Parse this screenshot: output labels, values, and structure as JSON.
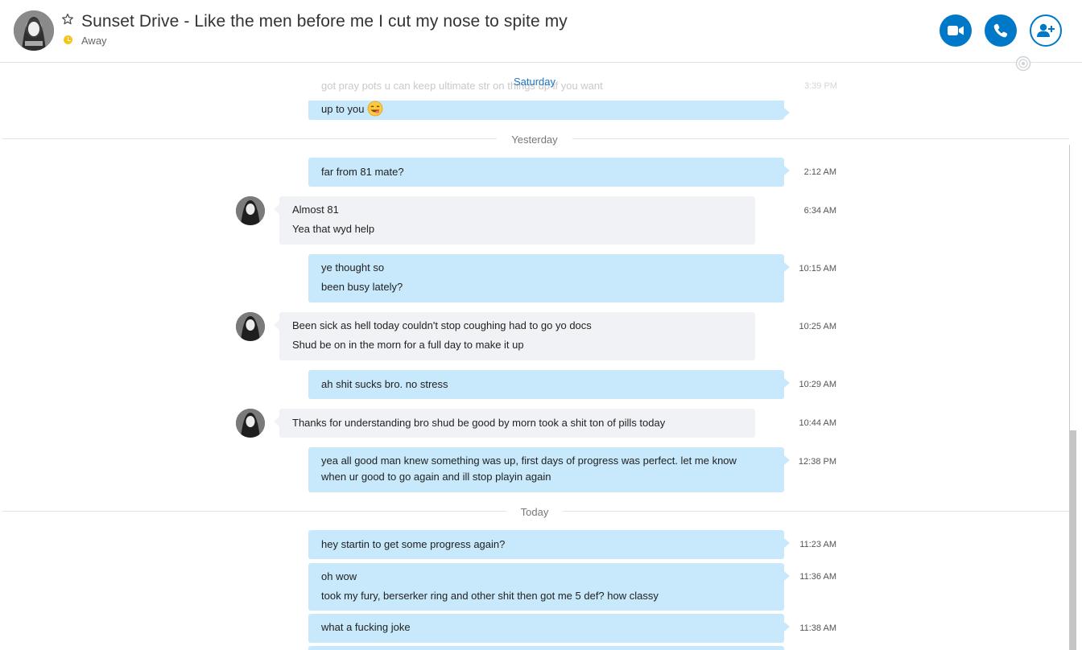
{
  "contact": {
    "name": "Sunset Drive - Like the men before me I cut my nose to spite my",
    "status": "Away",
    "status_color": "#f5c518"
  },
  "header_actions": [
    {
      "icon": "video-call-icon"
    },
    {
      "icon": "audio-call-icon"
    },
    {
      "icon": "add-participant-icon"
    }
  ],
  "colors": {
    "accent": "#0078c8",
    "outgoing_bubble": "#c7e9fb",
    "incoming_bubble": "#f0f2f5"
  },
  "sticky_date": "Saturday",
  "ghost_message": {
    "text": "got pray pots u can keep ultimate str on  things up if you want",
    "time": "3:39 PM"
  },
  "messages": [
    {
      "id": "m0",
      "dir": "out",
      "lines": [
        "up to you"
      ],
      "emoji": "yum-emoji-icon",
      "time": ""
    },
    {
      "id": "m1",
      "dir": "out",
      "lines": [
        "far from 81 mate?"
      ],
      "time": "2:12 AM"
    },
    {
      "id": "m2",
      "dir": "in",
      "lines": [
        "Almost 81",
        "Yea that wyd help"
      ],
      "time": "6:34 AM"
    },
    {
      "id": "m3",
      "dir": "out",
      "lines": [
        "ye thought so",
        "been busy lately?"
      ],
      "time": "10:15 AM"
    },
    {
      "id": "m4",
      "dir": "in",
      "lines": [
        "Been sick as hell today couldn't stop coughing had to go yo docs",
        "Shud be on in the morn for a full day to make it up"
      ],
      "time": "10:25 AM"
    },
    {
      "id": "m5",
      "dir": "out",
      "lines": [
        "ah shit sucks bro. no stress"
      ],
      "time": "10:29 AM"
    },
    {
      "id": "m6",
      "dir": "in",
      "lines": [
        "Thanks for understanding bro shud be good by morn took a shit ton of pills today"
      ],
      "time": "10:44 AM"
    },
    {
      "id": "m7",
      "dir": "out",
      "lines": [
        "yea all good man knew something was up, first days of progress was perfect. let me know",
        "when ur good to go again and ill stop playin again"
      ],
      "time": "12:38 PM"
    },
    {
      "id": "m8",
      "dir": "out",
      "lines": [
        "hey startin to get some progress again?"
      ],
      "time": "11:23 AM"
    },
    {
      "id": "m9",
      "dir": "out",
      "lines": [
        "oh wow",
        "took my fury, berserker ring and other shit then got me 5 def? how classy"
      ],
      "time": "11:36 AM"
    },
    {
      "id": "m10",
      "dir": "out",
      "lines": [
        "what  a fucking joke"
      ],
      "time": "11:38 AM"
    }
  ],
  "dividers": {
    "yesterday": "Yesterday",
    "today": "Today"
  }
}
